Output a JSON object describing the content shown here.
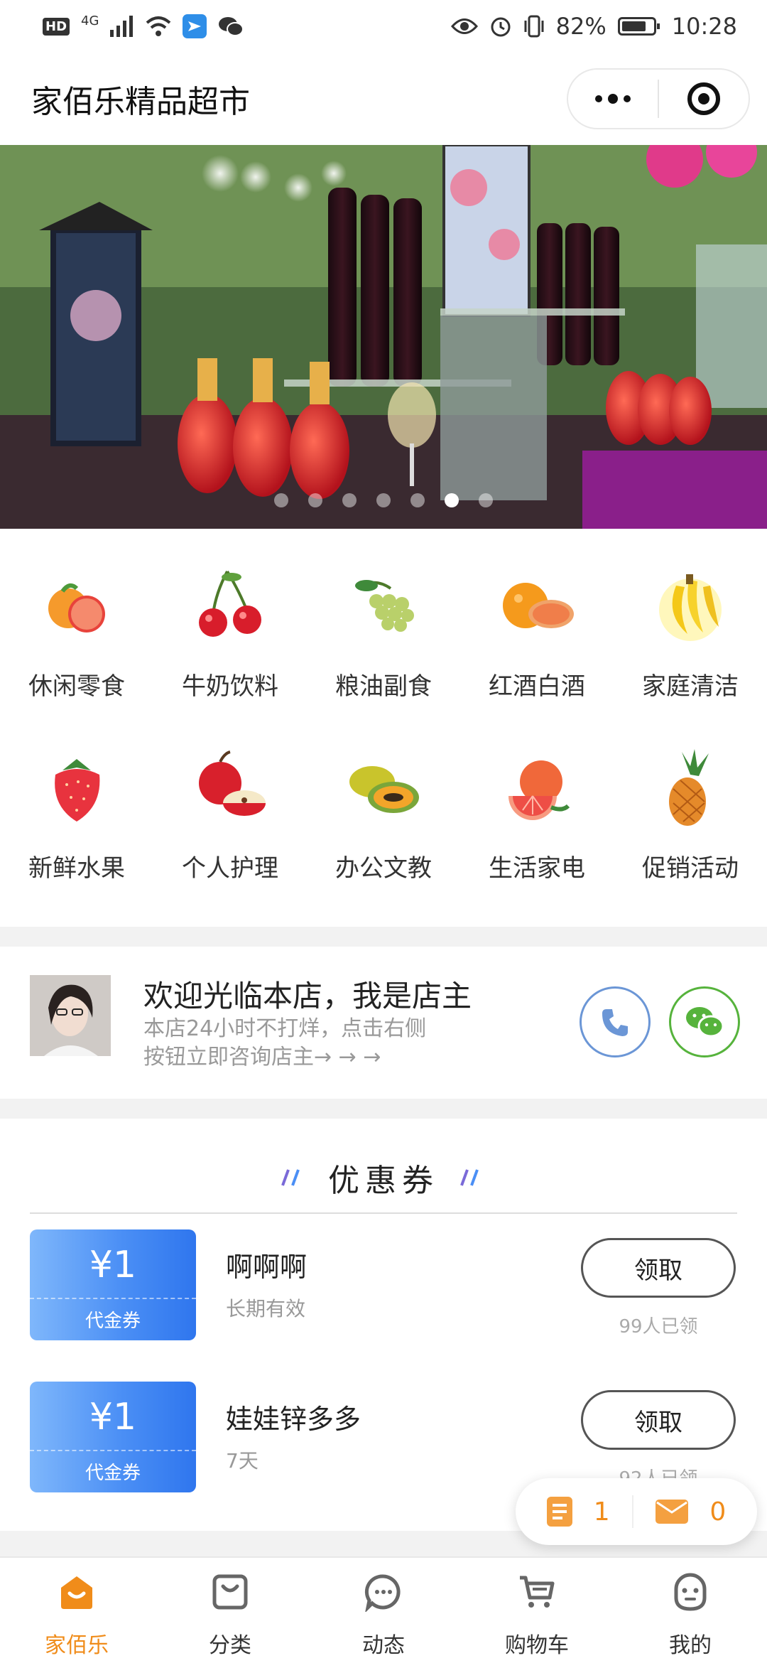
{
  "status_bar": {
    "network": "4G",
    "hd": "HD",
    "battery": "82%",
    "time": "10:28"
  },
  "header": {
    "title": "家佰乐精品超市"
  },
  "banner": {
    "slide_count": 7,
    "active_index": 5
  },
  "categories": [
    {
      "label": "休闲零食",
      "icon": "snacks-icon"
    },
    {
      "label": "牛奶饮料",
      "icon": "cherry-icon"
    },
    {
      "label": "粮油副食",
      "icon": "grapes-icon"
    },
    {
      "label": "红酒白酒",
      "icon": "orange-icon"
    },
    {
      "label": "家庭清洁",
      "icon": "banana-icon"
    },
    {
      "label": "新鲜水果",
      "icon": "strawberry-icon"
    },
    {
      "label": "个人护理",
      "icon": "apple-icon"
    },
    {
      "label": "办公文教",
      "icon": "papaya-icon"
    },
    {
      "label": "生活家电",
      "icon": "grapefruit-icon"
    },
    {
      "label": "促销活动",
      "icon": "pineapple-icon"
    }
  ],
  "shop": {
    "welcome": "欢迎光临本店，我是店主",
    "desc_line1": "本店24小时不打烊，点击右侧",
    "desc_line2": "按钮立即咨询店主→ → →"
  },
  "coupons": {
    "title": "优惠券",
    "items": [
      {
        "amount": "¥1",
        "type": "代金券",
        "name": "啊啊啊",
        "validity": "长期有效",
        "button": "领取",
        "claimed": "99人已领"
      },
      {
        "amount": "¥1",
        "type": "代金券",
        "name": "娃娃锌多多",
        "validity": "7天",
        "button": "领取",
        "claimed": "92人已领"
      }
    ]
  },
  "floating": {
    "orders_count": "1",
    "messages_count": "0"
  },
  "tabbar": {
    "items": [
      {
        "label": "家佰乐",
        "icon": "home-icon",
        "active": true
      },
      {
        "label": "分类",
        "icon": "category-icon",
        "active": false
      },
      {
        "label": "动态",
        "icon": "chat-icon",
        "active": false
      },
      {
        "label": "购物车",
        "icon": "cart-icon",
        "active": false
      },
      {
        "label": "我的",
        "icon": "profile-icon",
        "active": false
      }
    ]
  },
  "colors": {
    "accent": "#f08c1a",
    "coupon_blue": "#4b8ff5",
    "phone_blue": "#6b96d6",
    "wechat_green": "#56b33c"
  }
}
